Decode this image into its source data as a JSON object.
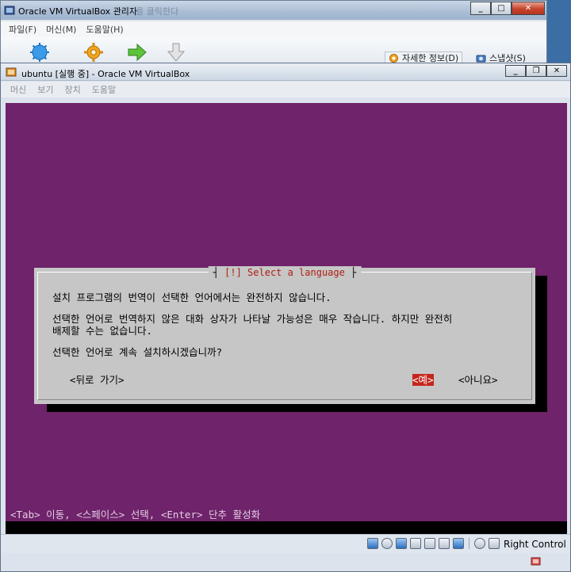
{
  "manager": {
    "title": "Oracle VM VirtualBox 관리자",
    "title_ghost": "를 클릭한다",
    "menu": [
      "파일(F)",
      "머신(M)",
      "도움말(H)"
    ],
    "toolbar_right": [
      {
        "label": "자세한 정보(D)",
        "icon": "gear-icon"
      },
      {
        "label": "스냅샷(S)",
        "icon": "camera-icon"
      }
    ]
  },
  "vm": {
    "title": "ubuntu [실행 중] - Oracle VM VirtualBox",
    "menu": [
      "머신",
      "보기",
      "장치",
      "도움말"
    ]
  },
  "installer": {
    "dialog_title_open": "┤",
    "dialog_title": "[!] Select a language",
    "dialog_title_close": "├",
    "lines": [
      "설치 프로그램의 번역이 선택한 언어에서는 완전하지 않습니다.",
      "선택한 언어로 번역하지 않은 대화 상자가 나타날 가능성은 매우 작습니다. 하지만 완전히",
      "배제할 수는 없습니다.",
      "선택한 언어로 계속 설치하시겠습니까?"
    ],
    "buttons": {
      "back": "<뒤로 가기>",
      "yes": "<예>",
      "no": "<아니요>"
    },
    "hint": "<Tab> 이동, <스페이스> 선택, <Enter> 단추 활성화"
  },
  "statusbar": {
    "host_key": "Right Control"
  },
  "colors": {
    "screen_bg": "#6e236a",
    "dialog_bg": "#c6c6c6",
    "focus_bg": "#c4261d",
    "title_red": "#b01e12"
  }
}
